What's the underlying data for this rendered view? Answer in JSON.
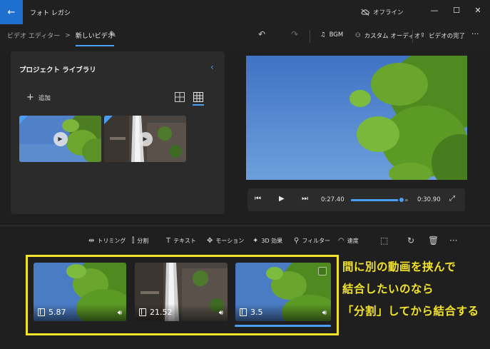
{
  "app": {
    "title": "フォト レガシ",
    "offline": "オフライン"
  },
  "breadcrumb": {
    "parent": "ビデオ エディター",
    "separator": ">",
    "current": "新しいビデオ"
  },
  "toolbar": {
    "bgm": "BGM",
    "custom_audio": "カスタム オーディオ",
    "finish_video": "ビデオの完了",
    "more": "···"
  },
  "library": {
    "title": "プロジェクト ライブラリ",
    "add": "追加",
    "collapse": "‹"
  },
  "player": {
    "current_time": "0:27.40",
    "total_time": "0:30.90",
    "progress": 0.887
  },
  "storyboard": {
    "trim": "トリミング",
    "split": "分割",
    "text": "テキスト",
    "motion": "モーション",
    "effects_3d": "3D 効果",
    "filter": "フィルター",
    "speed": "速度"
  },
  "clips": [
    {
      "duration": "5.87",
      "scene": "tree"
    },
    {
      "duration": "21.52",
      "scene": "waterfall"
    },
    {
      "duration": "3.5",
      "scene": "tree",
      "selected": true
    }
  ],
  "annotation": {
    "line1": "間に別の動画を挟んで",
    "line2": "結合したいのなら",
    "line3": "「分割」してから結合する"
  },
  "colors": {
    "accent": "#4a9ff5",
    "highlight": "#f2e22a",
    "background": "#1f1f1f"
  },
  "icons": {
    "back": "arrow-left-icon",
    "offline": "cloud-off-icon",
    "edit": "pencil-icon",
    "undo": "undo-icon",
    "redo": "redo-icon",
    "music": "music-note-icon",
    "custom_audio": "people-audio-icon",
    "export": "share-export-icon"
  }
}
